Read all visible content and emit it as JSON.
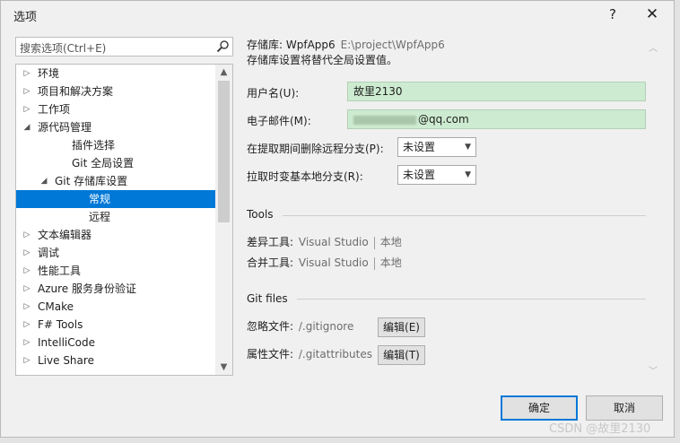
{
  "window": {
    "title": "选项",
    "help": "?",
    "close": "✕"
  },
  "search": {
    "placeholder": "搜索选项(Ctrl+E)"
  },
  "tree": [
    {
      "label": "环境",
      "arrow": "▷",
      "expanded": false,
      "selected": false
    },
    {
      "label": "项目和解决方案",
      "arrow": "▷",
      "expanded": false,
      "selected": false
    },
    {
      "label": "工作项",
      "arrow": "▷",
      "expanded": false,
      "selected": false
    },
    {
      "label": "源代码管理",
      "arrow": "◢",
      "expanded": true,
      "selected": false
    },
    {
      "label": "插件选择",
      "arrow": "",
      "expanded": false,
      "selected": false
    },
    {
      "label": "Git 全局设置",
      "arrow": "",
      "expanded": false,
      "selected": false
    },
    {
      "label": "Git 存储库设置",
      "arrow": "◢",
      "expanded": true,
      "selected": false
    },
    {
      "label": "常规",
      "arrow": "",
      "expanded": false,
      "selected": true
    },
    {
      "label": "远程",
      "arrow": "",
      "expanded": false,
      "selected": false
    },
    {
      "label": "文本编辑器",
      "arrow": "▷",
      "expanded": false,
      "selected": false
    },
    {
      "label": "调试",
      "arrow": "▷",
      "expanded": false,
      "selected": false
    },
    {
      "label": "性能工具",
      "arrow": "▷",
      "expanded": false,
      "selected": false
    },
    {
      "label": "Azure 服务身份验证",
      "arrow": "▷",
      "expanded": false,
      "selected": false
    },
    {
      "label": "CMake",
      "arrow": "▷",
      "expanded": false,
      "selected": false
    },
    {
      "label": "F# Tools",
      "arrow": "▷",
      "expanded": false,
      "selected": false
    },
    {
      "label": "IntelliCode",
      "arrow": "▷",
      "expanded": false,
      "selected": false
    },
    {
      "label": "Live Share",
      "arrow": "▷",
      "expanded": false,
      "selected": false
    }
  ],
  "settings": {
    "repo_label": "存储库: WpfApp6",
    "repo_path": "E:\\project\\WpfApp6",
    "repo_desc": "存储库设置将替代全局设置值。",
    "username_label": "用户名(U):",
    "username_value": "故里2130",
    "email_label": "电子邮件(M):",
    "email_value": "@qq.com",
    "prune_label": "在提取期间删除远程分支(P):",
    "prune_value": "未设置",
    "rebase_label": "拉取时变基本地分支(R):",
    "rebase_value": "未设置"
  },
  "tools": {
    "section": "Tools",
    "diff_label": "差异工具:",
    "diff_value": "Visual Studio",
    "diff_local": "本地",
    "merge_label": "合并工具:",
    "merge_value": "Visual Studio",
    "merge_local": "本地"
  },
  "git_files": {
    "section": "Git files",
    "ignore_label": "忽略文件:",
    "ignore_value": "/.gitignore",
    "ignore_edit": "编辑(E)",
    "attr_label": "属性文件:",
    "attr_value": "/.gitattributes",
    "attr_edit": "编辑(T)"
  },
  "footer": {
    "ok": "确定",
    "cancel": "取消"
  },
  "watermark": "CSDN @故里2130",
  "colors": {
    "accent": "#0078d7",
    "input_bg": "#cdebd0"
  }
}
